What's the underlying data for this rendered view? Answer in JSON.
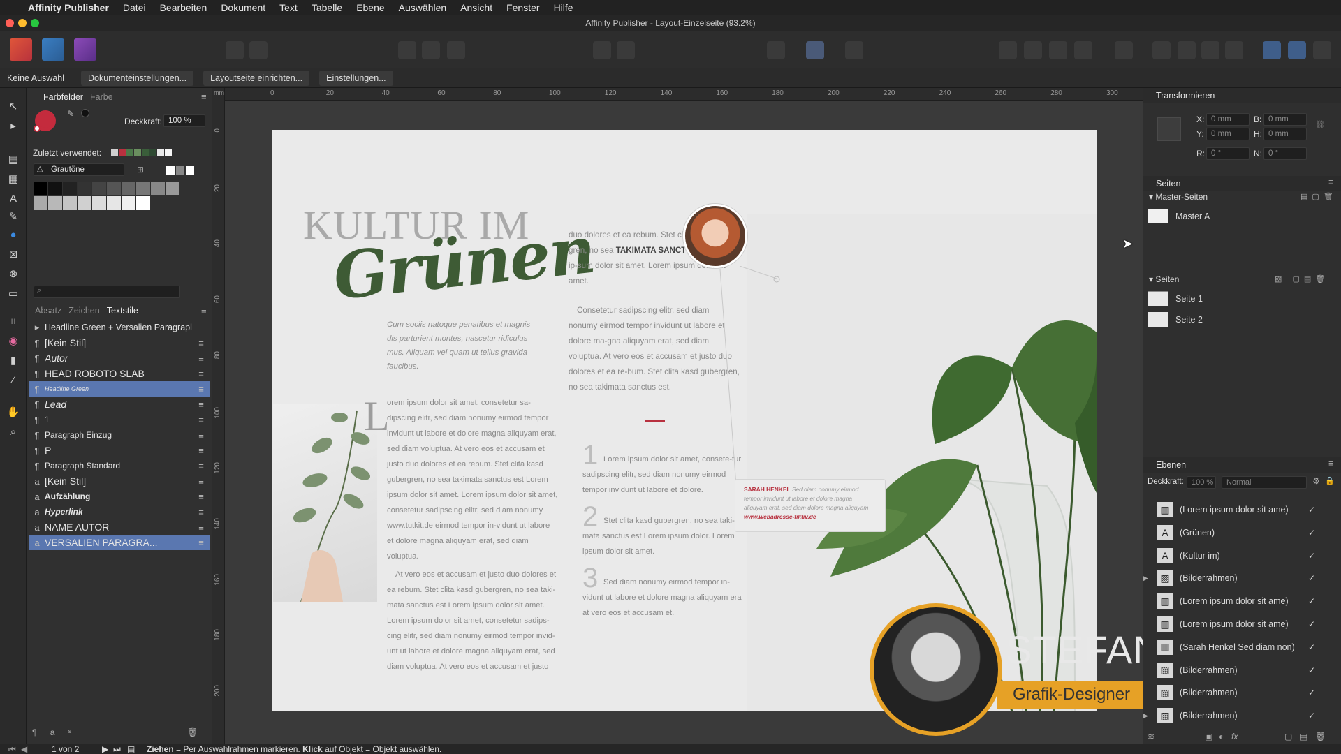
{
  "menubar": {
    "app_name": "Affinity Publisher",
    "items": [
      "Datei",
      "Bearbeiten",
      "Dokument",
      "Text",
      "Tabelle",
      "Ebene",
      "Auswählen",
      "Ansicht",
      "Fenster",
      "Hilfe"
    ]
  },
  "window": {
    "title": "Affinity Publisher - Layout-Einzelseite (93.2%)"
  },
  "context_bar": {
    "selection": "Keine Auswahl",
    "buttons": [
      "Dokumenteinstellungen...",
      "Layoutseite einrichten...",
      "Einstellungen..."
    ]
  },
  "swatches_panel": {
    "tabs": [
      "Farbfelder",
      "Farbe"
    ],
    "opacity_label": "Deckkraft:",
    "opacity_value": "100 %",
    "recent_label": "Zuletzt verwendet:",
    "palette_name": "Grautöne",
    "recent_colors": [
      "#d0d0d0",
      "#b8313f",
      "#4c7a4a",
      "#6a8f5f",
      "#3a5e3a",
      "#2f4a33",
      "#e8e8e8",
      "#f5f5f5"
    ],
    "grays_row1": [
      "#000000",
      "#111111",
      "#222222",
      "#333333",
      "#444444",
      "#555555",
      "#666666",
      "#777777",
      "#888888",
      "#999999"
    ],
    "grays_row2": [
      "#aaaaaa",
      "#b8b8b8",
      "#c4c4c4",
      "#d0d0d0",
      "#dcdcdc",
      "#e6e6e6",
      "#f0f0f0",
      "#ffffff"
    ]
  },
  "text_styles_panel": {
    "tabs": [
      "Absatz",
      "Zeichen",
      "Textstile"
    ],
    "group": "Headline Green + Versalien Paragrapl",
    "styles": [
      {
        "kind": "¶",
        "label": "[Kein Stil]"
      },
      {
        "kind": "¶",
        "label": "Autor"
      },
      {
        "kind": "¶",
        "label": "HEAD ROBOTO SLAB"
      },
      {
        "kind": "¶",
        "label": "Headline Green"
      },
      {
        "kind": "¶",
        "label": "Lead"
      },
      {
        "kind": "¶",
        "label": "1"
      },
      {
        "kind": "¶",
        "label": "Paragraph Einzug"
      },
      {
        "kind": "¶",
        "label": "P"
      },
      {
        "kind": "¶",
        "label": "Paragraph Standard"
      },
      {
        "kind": "a",
        "label": "[Kein Stil]"
      },
      {
        "kind": "a",
        "label": "Aufzählung"
      },
      {
        "kind": "a",
        "label": "Hyperlink"
      },
      {
        "kind": "a",
        "label": "NAME AUTOR"
      },
      {
        "kind": "a",
        "label": "VERSALIEN PARAGRA..."
      }
    ]
  },
  "ruler": {
    "unit": "mm",
    "labels": [
      "0",
      "20",
      "40",
      "60",
      "80",
      "100",
      "120",
      "140",
      "160",
      "180",
      "200",
      "220",
      "240",
      "260",
      "280",
      "300"
    ]
  },
  "ruler_left_labels": [
    "0",
    "20",
    "40",
    "60",
    "80",
    "100",
    "120",
    "140",
    "160",
    "180",
    "200"
  ],
  "layout": {
    "headline_top": "KULTUR IM",
    "headline_script": "Grünen",
    "lead": "Cum sociis natoque penatibus et magnis dis parturient montes, nascetur ridiculus mus. Aliquam vel quam ut tellus gravida faucibus.",
    "col2_p1_a": "duo dolores et ea rebum. Stet clita kasd guber-gren, no sea ",
    "col2_p1_bold": "TAKIMATA SANCTUS",
    "col2_p1_b": " est Lorem ip-sum dolor sit amet. Lorem ipsum dolor sit amet.",
    "col2_p2": "Consetetur sadipscing elitr, sed diam nonumy eirmod tempor invidunt ut labore et dolore ma-gna aliquyam erat, sed diam voluptua. At vero eos et accusam et justo duo dolores et ea re-bum. Stet clita kasd gubergren, no sea takimata sanctus est.",
    "dropcap": "L",
    "col1_body": "orem ipsum dolor sit amet, consetetur sa-dipscing elitr, sed diam nonumy eirmod tempor invidunt ut labore et dolore magna aliquyam erat, sed diam voluptua. At vero eos et accusam et justo duo dolores et ea rebum. Stet clita kasd gubergren, no sea takimata sanctus est Lorem ipsum dolor sit amet. Lorem ipsum dolor sit amet, consetetur sadipscing elitr, sed diam nonumy www.tutkit.de eirmod tempor in-vidunt ut labore et dolore magna aliquyam erat, sed diam voluptua.",
    "col1_body2": "At vero eos et accusam et justo duo dolores et ea rebum. Stet clita kasd gubergren, no sea taki-mata sanctus est Lorem ipsum dolor sit amet. Lorem ipsum dolor sit amet, consetetur sadips-cing elitr, sed diam nonumy eirmod tempor invid-unt ut labore et dolore magna aliquyam erat, sed diam voluptua. At vero eos et accusam et justo",
    "list": [
      {
        "n": "1",
        "text": "Lorem ipsum dolor sit amet, consete-tur sadipscing elitr, sed diam nonumy eirmod tempor invidunt ut labore et dolore."
      },
      {
        "n": "2",
        "text": "Stet clita kasd gubergren, no sea taki-mata sanctus est Lorem ipsum dolor. Lorem ipsum dolor sit amet."
      },
      {
        "n": "3",
        "text": "Sed diam nonumy eirmod tempor in-vidunt ut labore et dolore magna aliquyam era at vero eos et accusam et."
      }
    ],
    "quote_author": "SARAH HENKEL",
    "quote_text": "Sed diam nonumy eirmod tempor invidunt ut labore et dolore magna aliquyam erat, sed diam dolore magna aliquyam",
    "quote_url": "www.webadresse-fiktiv.de"
  },
  "overlay": {
    "name": "STEFAN RIEDL",
    "role": "Grafik-Designer"
  },
  "transform_panel": {
    "title": "Transformieren",
    "x_label": "X:",
    "x_value": "0 mm",
    "y_label": "Y:",
    "y_value": "0 mm",
    "w_label": "B:",
    "w_value": "0 mm",
    "h_label": "H:",
    "h_value": "0 mm",
    "r_label": "R:",
    "r_value": "0 °",
    "n_label": "N:",
    "n_value": "0 °"
  },
  "pages_panel": {
    "title": "Seiten",
    "master_header": "Master-Seiten",
    "masters": [
      "Master A"
    ],
    "pages_header": "Seiten",
    "pages": [
      "Seite 1",
      "Seite 2"
    ]
  },
  "layers_panel": {
    "title": "Ebenen",
    "opacity_label": "Deckkraft:",
    "opacity_value": "100 %",
    "blend_mode": "Normal",
    "layers": [
      {
        "icon": "text-frame",
        "name": "(Lorem ipsum dolor sit ame)"
      },
      {
        "icon": "art-text",
        "name": "(Grünen)"
      },
      {
        "icon": "art-text",
        "name": "(Kultur im)"
      },
      {
        "icon": "picture",
        "name": "(Bilderrahmen)"
      },
      {
        "icon": "text-frame",
        "name": "(Lorem ipsum dolor sit ame)"
      },
      {
        "icon": "text-frame",
        "name": "(Lorem ipsum dolor sit ame)"
      },
      {
        "icon": "text-frame",
        "name": "(Sarah Henkel Sed diam non)"
      },
      {
        "icon": "picture",
        "name": "(Bilderrahmen)"
      },
      {
        "icon": "picture",
        "name": "(Bilderrahmen)"
      },
      {
        "icon": "picture",
        "name": "(Bilderrahmen)"
      }
    ]
  },
  "status": {
    "page_indicator": "1 von 2",
    "hint_bold1": "Ziehen",
    "hint_text1": " = Per Auswahlrahmen markieren. ",
    "hint_bold2": "Klick",
    "hint_text2": " auf Objekt = Objekt auswählen."
  }
}
